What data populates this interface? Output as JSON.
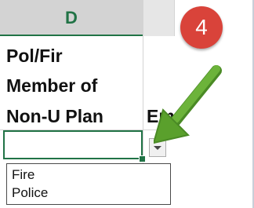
{
  "column_header": {
    "label": "D"
  },
  "header_cells": {
    "line1": "Pol/Fir",
    "line2": "Member of",
    "line3": "Non-U Plan"
  },
  "neighbor_cell": {
    "partial_text": "Em"
  },
  "active_cell": {
    "value": ""
  },
  "dropdown": {
    "options": [
      "Fire",
      "Police"
    ]
  },
  "callout": {
    "number": "4",
    "color": "#d9433a"
  },
  "colors": {
    "excel_green": "#217346",
    "arrow_green": "#5aa02c"
  },
  "icons": {
    "dropdown_arrow": "chevron-down-icon",
    "pointer": "green-arrow-icon"
  }
}
